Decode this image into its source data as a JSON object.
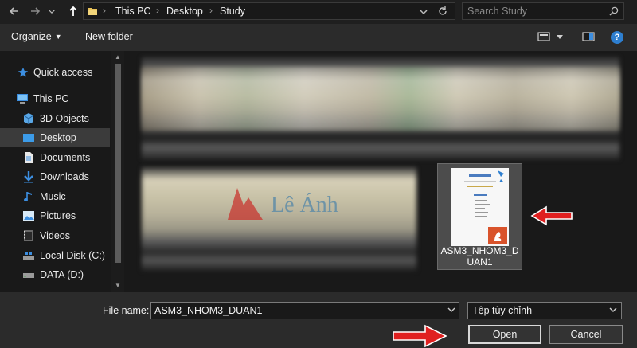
{
  "address_bar": {
    "breadcrumbs": [
      "This PC",
      "Desktop",
      "Study"
    ]
  },
  "search": {
    "placeholder": "Search Study"
  },
  "toolbar": {
    "organize_label": "Organize",
    "new_folder_label": "New folder",
    "help_label": "?"
  },
  "sidebar": {
    "items": [
      {
        "label": "Quick access",
        "icon": "star-icon"
      },
      {
        "label": "This PC",
        "icon": "computer-icon"
      },
      {
        "label": "3D Objects",
        "icon": "3d-objects-icon"
      },
      {
        "label": "Desktop",
        "icon": "desktop-icon",
        "selected": true
      },
      {
        "label": "Documents",
        "icon": "documents-icon"
      },
      {
        "label": "Downloads",
        "icon": "download-icon"
      },
      {
        "label": "Music",
        "icon": "music-icon"
      },
      {
        "label": "Pictures",
        "icon": "pictures-icon"
      },
      {
        "label": "Videos",
        "icon": "videos-icon"
      },
      {
        "label": "Local Disk (C:)",
        "icon": "drive-icon"
      },
      {
        "label": "DATA (D:)",
        "icon": "drive-icon"
      }
    ]
  },
  "main": {
    "watermark_text": "Lê Ánh",
    "selected_file": {
      "name": "ASM3_NHOM3_DUAN1"
    }
  },
  "footer": {
    "file_name_label": "File name:",
    "file_name_value": "ASM3_NHOM3_DUAN1",
    "file_type": "Tệp tùy chỉnh",
    "open_label": "Open",
    "cancel_label": "Cancel"
  },
  "colors": {
    "accent_blue": "#2e7fd0",
    "arrow_red": "#e02020",
    "selected_bg": "#3b3b3b"
  }
}
